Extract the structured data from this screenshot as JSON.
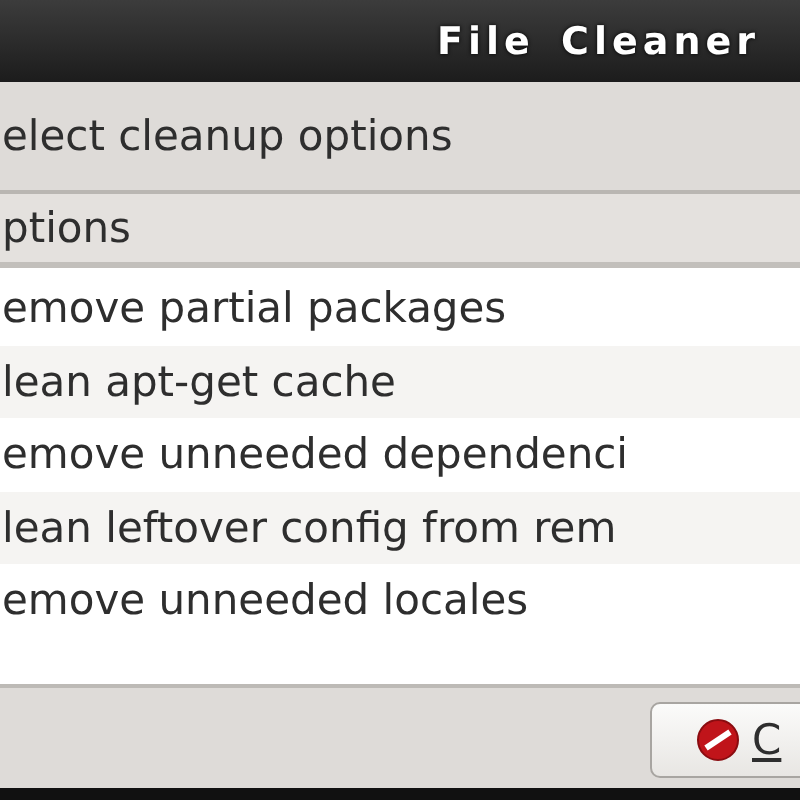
{
  "window": {
    "title": "File Cleaner"
  },
  "heading": "elect cleanup options",
  "list": {
    "column_header": "ptions",
    "rows": [
      {
        "label": "emove partial packages"
      },
      {
        "label": "lean apt-get cache"
      },
      {
        "label": "emove unneeded dependenci"
      },
      {
        "label": "lean leftover config from rem"
      },
      {
        "label": "emove unneeded locales"
      }
    ]
  },
  "buttons": [
    {
      "label": "C"
    }
  ]
}
